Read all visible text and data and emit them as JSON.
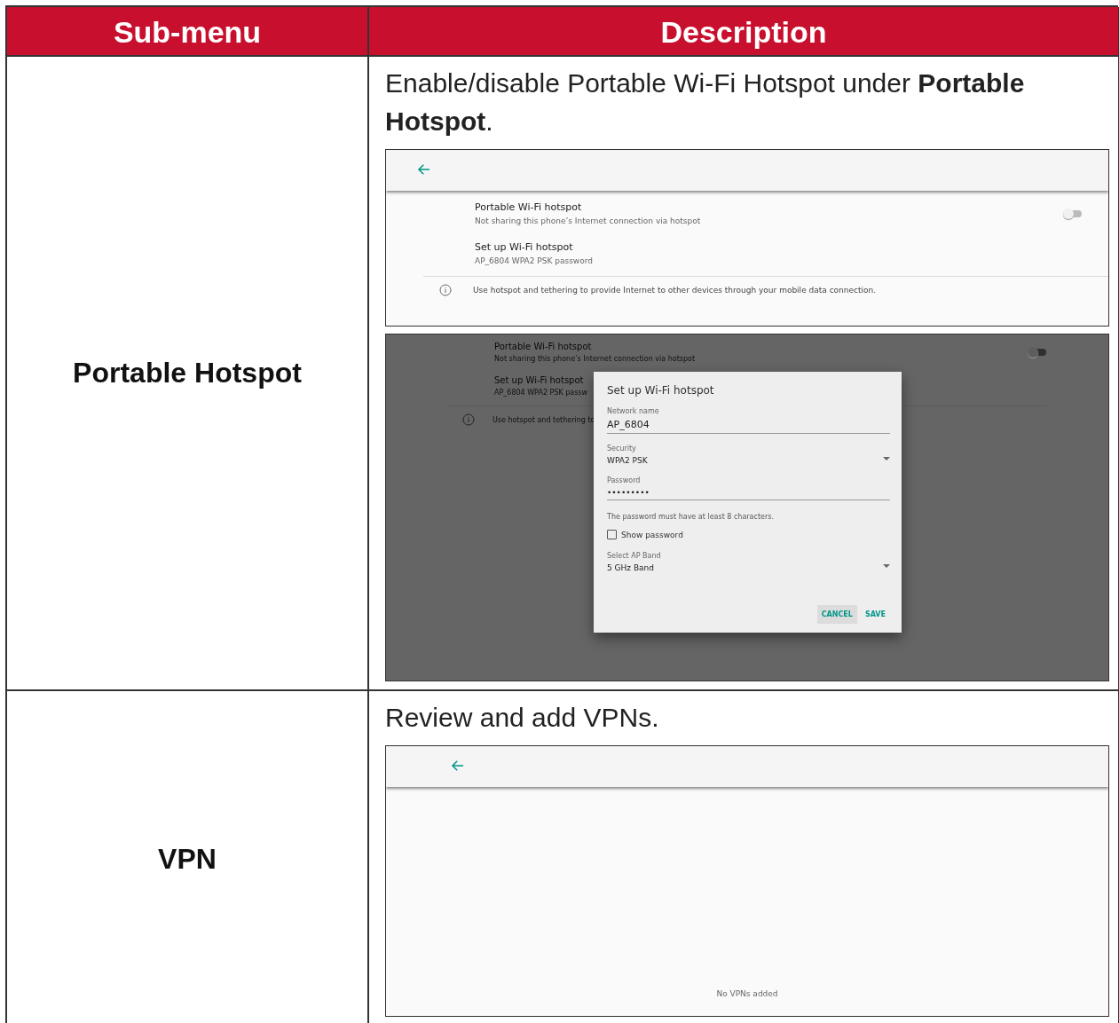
{
  "table": {
    "columns": [
      "Sub-menu",
      "Description"
    ],
    "rows": [
      {
        "submenu": "Portable Hotspot",
        "description": "Enable/disable Portable Wi-Fi Hotspot under **Portable Hotspot**.",
        "screens": [
          {
            "kind": "settings",
            "items": [
              {
                "title": "Portable Wi-Fi hotspot",
                "subtitle": "Not sharing this phone’s Internet connection via hotspot",
                "switch_on": false
              },
              {
                "title": "Set up Wi-Fi hotspot",
                "subtitle": "AP_6804 WPA2 PSK password"
              }
            ],
            "info": "Use hotspot and tethering to provide Internet to other devices through your mobile data connection."
          },
          {
            "kind": "dialog",
            "items": [
              {
                "title": "Portable Wi-Fi hotspot",
                "subtitle": "Not sharing this phone’s Internet connection via hotspot",
                "switch_on": false
              },
              {
                "title": "Set up Wi-Fi hotspot",
                "subtitle": "AP_6804 WPA2 PSK passw"
              }
            ],
            "info": "Use hotspot and tethering to",
            "dialog": {
              "title": "Set up Wi-Fi hotspot",
              "fields": [
                {
                  "kind": "text",
                  "label": "Network name",
                  "value": "AP_6804"
                },
                {
                  "kind": "select",
                  "label": "Security",
                  "value": "WPA2 PSK"
                },
                {
                  "kind": "password",
                  "label": "Password",
                  "value": "•••••••••"
                },
                {
                  "kind": "hint",
                  "value": "The password must have at least 8 characters."
                },
                {
                  "kind": "checkbox",
                  "label": "Show password",
                  "checked": false
                },
                {
                  "kind": "select",
                  "label": "Select AP Band",
                  "value": "5 GHz Band"
                }
              ],
              "buttons": [
                {
                  "label": "CANCEL",
                  "focused": true
                },
                {
                  "label": "SAVE",
                  "focused": false
                }
              ]
            }
          }
        ]
      },
      {
        "submenu": "VPN",
        "description": "Review and add VPNs.",
        "screens": [
          {
            "kind": "empty",
            "message": "No VPNs added"
          }
        ]
      }
    ]
  }
}
